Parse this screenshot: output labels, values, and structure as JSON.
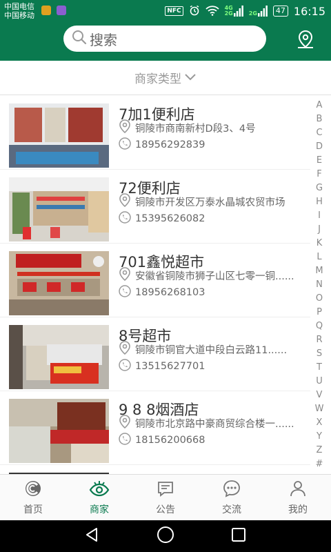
{
  "status_bar": {
    "carrier_1": "中国电信",
    "carrier_2": "中国移动",
    "nfc": "NFC",
    "net_top": "4G",
    "net_bottom": "2G",
    "net2": "2G",
    "battery": "47",
    "time": "16:15"
  },
  "header": {
    "search_placeholder": "搜索",
    "location_icon": "map-pin-icon"
  },
  "filter": {
    "label": "商家类型",
    "icon": "chevron-down-icon"
  },
  "stores": [
    {
      "name": "7加1便利店",
      "address": "铜陵市商南新村D段3、4号",
      "phone": "18956292839"
    },
    {
      "name": "72便利店",
      "address": "铜陵市开发区万泰水晶城农贸市场",
      "phone": "15395626082"
    },
    {
      "name": "701鑫悦超市",
      "address": "安徽省铜陵市狮子山区七零一铜......",
      "phone": "18956268103"
    },
    {
      "name": "8号超市",
      "address": "铜陵市铜官大道中段白云路11......",
      "phone": "13515627701"
    },
    {
      "name": "9 8 8烟酒店",
      "address": "铜陵市北京路中豪商贸综合楼一......",
      "phone": "18156200668"
    }
  ],
  "alphabet": [
    "A",
    "B",
    "C",
    "D",
    "E",
    "F",
    "G",
    "H",
    "I",
    "J",
    "K",
    "L",
    "M",
    "N",
    "O",
    "P",
    "Q",
    "R",
    "S",
    "T",
    "U",
    "V",
    "W",
    "X",
    "Y",
    "Z",
    "#"
  ],
  "tabs": [
    {
      "label": "首页",
      "icon": "home-logo-icon",
      "active": false
    },
    {
      "label": "商家",
      "icon": "eye-icon",
      "active": true
    },
    {
      "label": "公告",
      "icon": "notice-icon",
      "active": false
    },
    {
      "label": "交流",
      "icon": "chat-bubble-icon",
      "active": false
    },
    {
      "label": "我的",
      "icon": "person-icon",
      "active": false
    }
  ],
  "colors": {
    "brand_green": "#0a7a4f",
    "text_gray": "#666666",
    "divider": "#e0e0e0"
  }
}
